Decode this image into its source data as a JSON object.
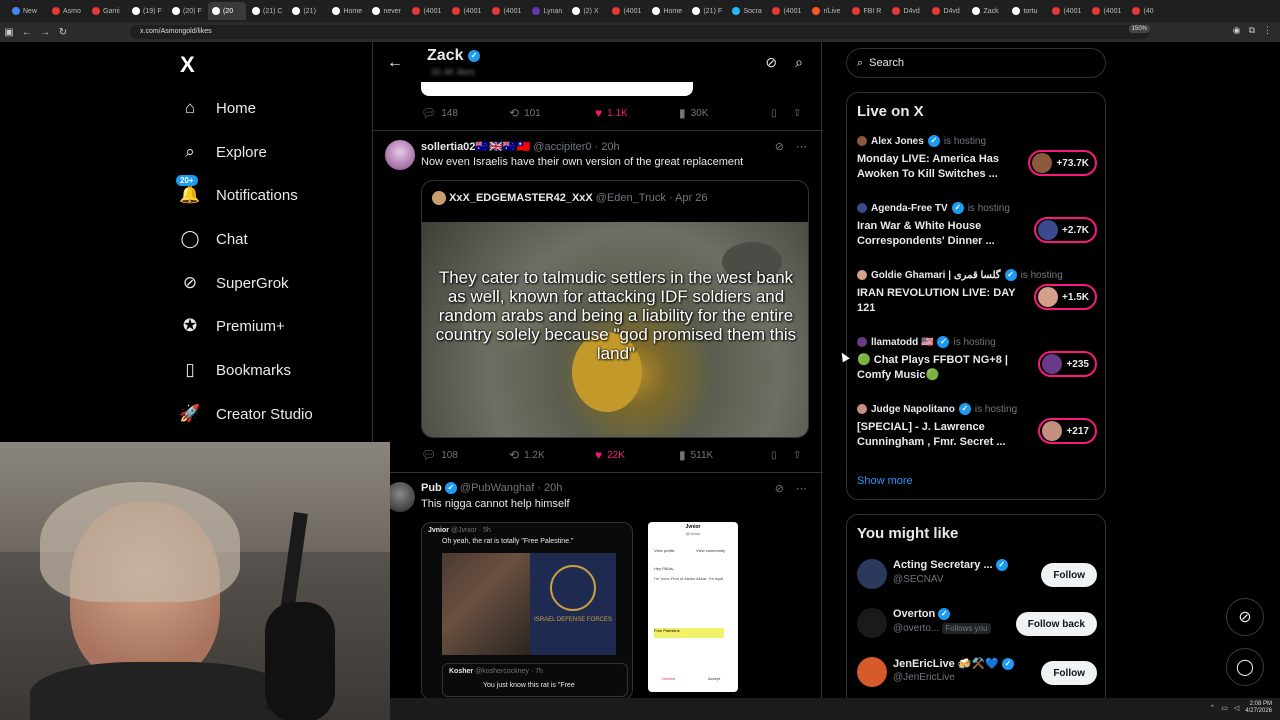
{
  "browser": {
    "tabs": [
      {
        "label": "New",
        "color": "#4285f4",
        "active": false
      },
      {
        "label": "Asmo",
        "color": "#e53935",
        "active": false
      },
      {
        "label": "Gami",
        "color": "#e53935",
        "active": false
      },
      {
        "label": "(19) F",
        "color": "#ffffff",
        "active": false
      },
      {
        "label": "(20) F",
        "color": "#ffffff",
        "active": false
      },
      {
        "label": "(20",
        "color": "#ffffff",
        "active": true
      },
      {
        "label": "(21) C",
        "color": "#ffffff",
        "active": false
      },
      {
        "label": "(21)",
        "color": "#ffffff",
        "active": false
      },
      {
        "label": "Home",
        "color": "#ffffff",
        "active": false
      },
      {
        "label": "never",
        "color": "#ffffff",
        "active": false
      },
      {
        "label": "(4001",
        "color": "#e53935",
        "active": false
      },
      {
        "label": "(4001",
        "color": "#e53935",
        "active": false
      },
      {
        "label": "(4001",
        "color": "#e53935",
        "active": false
      },
      {
        "label": "Lynan",
        "color": "#5e35b1",
        "active": false
      },
      {
        "label": "(2) X",
        "color": "#ffffff",
        "active": false
      },
      {
        "label": "(4001",
        "color": "#e53935",
        "active": false
      },
      {
        "label": "Home",
        "color": "#ffffff",
        "active": false
      },
      {
        "label": "(21) F",
        "color": "#ffffff",
        "active": false
      },
      {
        "label": "Socra",
        "color": "#29b6f6",
        "active": false
      },
      {
        "label": "(4001",
        "color": "#e53935",
        "active": false
      },
      {
        "label": "r/Live",
        "color": "#ff5722",
        "active": false
      },
      {
        "label": "FBI R",
        "color": "#e53935",
        "active": false
      },
      {
        "label": "D4vd",
        "color": "#e53935",
        "active": false
      },
      {
        "label": "D4vd",
        "color": "#e53935",
        "active": false
      },
      {
        "label": "Zack",
        "color": "#ffffff",
        "active": false
      },
      {
        "label": "tortu",
        "color": "#ffffff",
        "active": false
      },
      {
        "label": "(4001",
        "color": "#e53935",
        "active": false
      },
      {
        "label": "(4001",
        "color": "#e53935",
        "active": false
      },
      {
        "label": "(40",
        "color": "#e53935",
        "active": false
      }
    ],
    "url": "x.com/Asmongold/likes",
    "zoom": "150%"
  },
  "nav": {
    "logo": "X",
    "items": [
      {
        "label": "Home",
        "icon": "⌂"
      },
      {
        "label": "Explore",
        "icon": "⌕"
      },
      {
        "label": "Notifications",
        "icon": "🔔",
        "badge": "20+"
      },
      {
        "label": "Chat",
        "icon": "◯"
      },
      {
        "label": "SuperGrok",
        "icon": "⊘"
      },
      {
        "label": "Premium+",
        "icon": "✪"
      },
      {
        "label": "Bookmarks",
        "icon": "▯"
      },
      {
        "label": "Creator Studio",
        "icon": "🚀"
      }
    ]
  },
  "profile": {
    "name": "Zack",
    "sub": "30.4K likes"
  },
  "post0": {
    "replies": "148",
    "reposts": "101",
    "likes": "1.1K",
    "views": "30K"
  },
  "post1": {
    "name": "sollertia02",
    "flags": "🇦🇺🇬🇧🇦🇺🇹🇼",
    "handle": "@accipiter0",
    "time": "· 20h",
    "text": "Now even Israelis have their own version of the great replacement",
    "quote": {
      "name": "XxX_EDGEMASTER42_XxX",
      "handle": "@Eden_Truck",
      "time": "· Apr 26",
      "caption": "They cater to talmudic settlers in the west bank as well, known for attacking IDF soldiers and random arabs and being a liability for the entire country solely because \"god promised them this land\""
    },
    "replies": "108",
    "reposts": "1.2K",
    "likes": "22K",
    "views": "511K"
  },
  "post2": {
    "name": "Pub",
    "handle": "@PubWanghaf",
    "time": "· 20h",
    "text": "This nigga cannot help himself",
    "media": {
      "inner_name": "Jvnior",
      "inner_handle": "@Jvnior · 5h",
      "inner_text": "Oh yeah, the rat is totally \"Free Palestine.\"",
      "shirt_text": "ISRAEL DEFENSE FORCES",
      "reply_name": "Kosher",
      "reply_handle": "@koshercockney · 7h",
      "reply_text": "You just know this rat is \"Free"
    },
    "doc": {
      "title": "Jvnior",
      "handle": "@Jvnior",
      "view_profile": "View profile",
      "view_community": "View community",
      "greeting": "Hey PAIAs,",
      "body": "I'm Vnior-First of Allahu Akbar, I'm loyal",
      "highlight": "Free Palestine",
      "decline": "Decline",
      "accept": "Accept"
    }
  },
  "right": {
    "search_placeholder": "Search",
    "live_title": "Live on X",
    "live": [
      {
        "host": "Alex Jones",
        "hosting": "is hosting",
        "title": "Monday LIVE: America Has Awoken To Kill Switches ...",
        "count": "+73.7K",
        "color": "#8b5a3c"
      },
      {
        "host": "Agenda-Free TV",
        "hosting": "is hosting",
        "title": "Iran War & White House Correspondents' Dinner ...",
        "count": "+2.7K",
        "color": "#3a4a8c"
      },
      {
        "host": "Goldie Ghamari | گلسا قمری",
        "hosting": "is hosting",
        "title": "IRAN REVOLUTION LIVE: DAY 121",
        "count": "+1.5K",
        "color": "#d4a08a"
      },
      {
        "host": "llamatodd 🇺🇸",
        "hosting": "is hosting",
        "title": "🟢 Chat Plays FFBOT NG+8 | Comfy Music🟢",
        "count": "+235",
        "color": "#6a3a8a"
      },
      {
        "host": "Judge Napolitano",
        "hosting": "is hosting",
        "title": "[SPECIAL] - J. Lawrence Cunningham , Fmr. Secret ...",
        "count": "+217",
        "color": "#c49080"
      }
    ],
    "show_more": "Show more",
    "follow_title": "You might like",
    "follow": [
      {
        "name": "Acting Secretary ...",
        "handle": "@SECNAV",
        "button": "Follow",
        "follows_you": "",
        "color": "#2b3a5c"
      },
      {
        "name": "Overton",
        "handle": "@overto...",
        "button": "Follow back",
        "follows_you": "Follows you",
        "color": "#1a1a1a"
      },
      {
        "name": "JenEricLive 🍻⚒️💙",
        "handle": "@JenEricLive",
        "button": "Follow",
        "follows_you": "",
        "color": "#d65a2a"
      }
    ]
  },
  "taskbar": {
    "time": "2:08 PM",
    "date": "4/27/2026"
  }
}
